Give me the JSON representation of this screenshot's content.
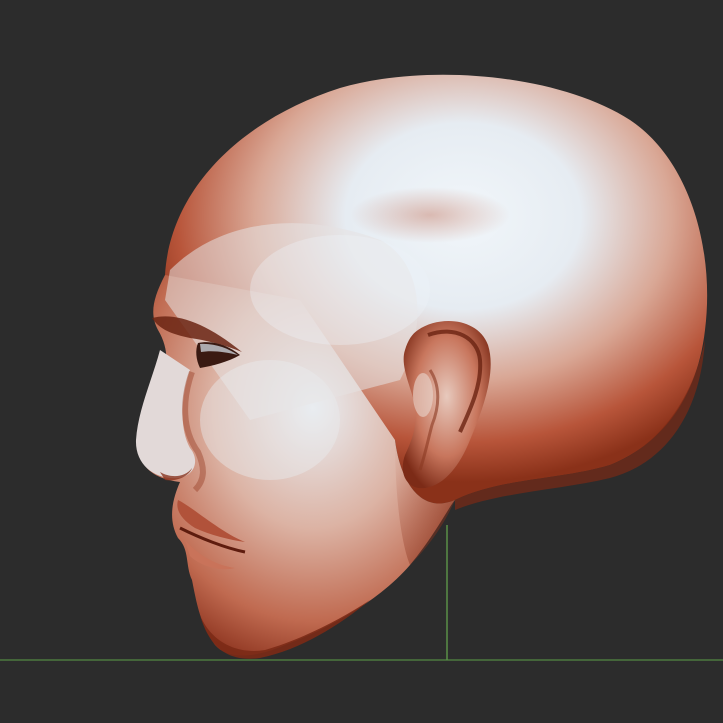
{
  "viewport": {
    "background_color": "#2c2c2c",
    "floor_grid_color": "#4d7a3f",
    "axis_line_color": "#5a8f46"
  },
  "model": {
    "material_base_color": "#c27258",
    "material_highlight_color": "#eaf2f8",
    "material_shadow_color": "#7a2e1a"
  }
}
